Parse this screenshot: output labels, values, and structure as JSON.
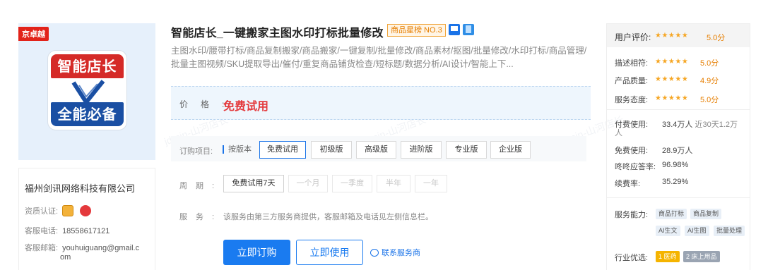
{
  "logo": {
    "badge": "京卓越",
    "top_text": "智能店长",
    "bottom_text": "全能必备"
  },
  "company": {
    "name": "福州剑讯网络科技有限公司",
    "cert_label": "资质认证:",
    "phone_label": "客服电话:",
    "phone": "18558617121",
    "email_label": "客服邮箱:",
    "email_line1": "youhuiguang@gmail.c",
    "email_line2": "om"
  },
  "product": {
    "title": "智能店长_一键搬家主图水印打标批量修改",
    "rank_badge": "商品星榜 NO.3",
    "description": "主图水印/腰带打标/商品复制搬家/商品搬家/一键复制/批量修改/商品素材/抠图/批量修改/水印打标/商品管理/批量主图视频/SKU提取导出/催付/重复商品铺货检查/短标题/数据分析/AI设计/智能上下..."
  },
  "price": {
    "label": "价格:",
    "value": "免费试用"
  },
  "order": {
    "label": "订购项目:",
    "by_version": "按版本",
    "options": [
      {
        "label": "免费试用",
        "state": "selected"
      },
      {
        "label": "初级版",
        "state": "normal"
      },
      {
        "label": "高级版",
        "state": "normal"
      },
      {
        "label": "进阶版",
        "state": "normal"
      },
      {
        "label": "专业版",
        "state": "normal"
      },
      {
        "label": "企业版",
        "state": "normal"
      }
    ]
  },
  "period": {
    "label": "周期:",
    "options": [
      {
        "label": "免费试用7天",
        "state": "selected"
      },
      {
        "label": "一个月",
        "state": "disabled"
      },
      {
        "label": "一季度",
        "state": "disabled"
      },
      {
        "label": "半年",
        "state": "disabled"
      },
      {
        "label": "一年",
        "state": "disabled"
      }
    ]
  },
  "service": {
    "label": "服务:",
    "text": "该服务由第三方服务商提供，客服邮箱及电话见左侧信息栏。"
  },
  "actions": {
    "subscribe": "立即订购",
    "use_now": "立即使用",
    "contact": "联系服务商"
  },
  "ratings": {
    "header_label": "用户评价:",
    "header_score": "5.0分",
    "rows": [
      {
        "label": "描述相符:",
        "score": "5.0分"
      },
      {
        "label": "产品质量:",
        "score": "4.9分"
      },
      {
        "label": "服务态度:",
        "score": "5.0分"
      }
    ],
    "stars": "★★★★★",
    "stats": {
      "paid_label": "付费使用:",
      "paid_value": "33.4万人",
      "paid_recent": "近30天1.2万",
      "paid_recent_unit": "人",
      "free_label": "免费使用:",
      "free_value": "28.9万人",
      "response_label": "咚咚应答率:",
      "response_value": "96.98%",
      "renew_label": "续费率:",
      "renew_value": "35.29%"
    },
    "capability_label": "服务能力:",
    "capabilities": [
      "商品打标",
      "商品复制",
      "AI生文",
      "AI生图",
      "批量处理"
    ],
    "industry_label": "行业优选:",
    "industry_tags": [
      "1 医药",
      "2 床上用品"
    ]
  },
  "watermark": "jd-pin-山河店长",
  "colors": {
    "accent": "#1a7bf0",
    "price_red": "#e4393c",
    "star": "#f6a623",
    "rank_orange": "#e67e00"
  }
}
